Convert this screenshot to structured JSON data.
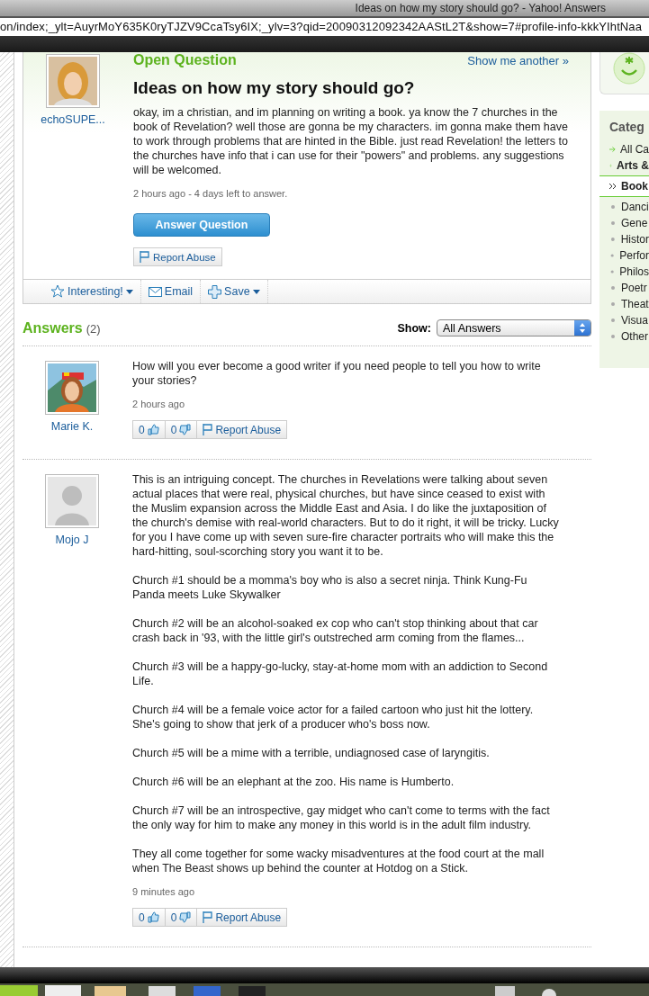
{
  "window": {
    "title": "Ideas on how my story should go? - Yahoo! Answers"
  },
  "address_bar": {
    "url": "on/index;_ylt=AuyrMoY635K0ryTJZV9CcaTsy6IX;_ylv=3?qid=20090312092342AAStL2T&show=7#profile-info-kkkYIhtNaa"
  },
  "question": {
    "status": "Open Question",
    "show_another": "Show me another »",
    "asker": "echoSUPE...",
    "title": "Ideas on how my story should go?",
    "body": "okay, im a christian, and im planning on writing a book. ya know the 7 churches in the book of Revelation? well those are gonna be my characters. im gonna make them have to work through problems that are hinted in the Bible. just read Revelation! the letters to the churches have info that i can use for their \"powers\" and problems. any suggestions will be welcomed.",
    "meta": "2 hours ago - 4 days left to answer.",
    "answer_button": "Answer Question",
    "report": "Report Abuse",
    "actions": [
      {
        "kind": "star",
        "label": "Interesting!",
        "menu": true
      },
      {
        "kind": "mail",
        "label": "Email",
        "menu": false
      },
      {
        "kind": "plus",
        "label": "Save",
        "menu": true
      }
    ]
  },
  "answers": {
    "title": "Answers",
    "count": "(2)",
    "show_label": "Show:",
    "show_value": "All Answers",
    "items": [
      {
        "name": "Marie K.",
        "paragraphs": [
          "How will you ever become a good writer if you need people to tell you how to write your stories?"
        ],
        "time": "2 hours ago",
        "up": "0",
        "down": "0",
        "report": "Report Abuse"
      },
      {
        "name": "Mojo J",
        "paragraphs": [
          "This is an intriguing concept. The churches in Revelations were talking about seven actual places that were real, physical churches, but have since ceased to exist with the Muslim expansion across the Middle East and Asia. I do like the juxtaposition of the church's demise with real-world characters. But to do it right, it will be tricky. Lucky for you I have come up with seven sure-fire character portraits who will make this the hard-hitting, soul-scorching story you want it to be.",
          "Church #1 should be a momma's boy who is also a secret ninja. Think Kung-Fu Panda meets Luke Skywalker",
          "Church #2 will be an alcohol-soaked ex cop who can't stop thinking about that car crash back in '93, with the little girl's outstreched arm coming from the flames...",
          "Church #3 will be a happy-go-lucky, stay-at-home mom with an addiction to Second Life.",
          "Church #4 will be a female voice actor for a failed cartoon who just hit the lottery. She's going to show that jerk of a producer who's boss now.",
          "Church #5 will be a mime with a terrible, undiagnosed case of laryngitis.",
          "Church #6 will be an elephant at the zoo. His name is Humberto.",
          "Church #7 will be an introspective, gay midget who can't come to terms with the fact the only way for him to make any money in this world is in the adult film industry.",
          "They all come together for some wacky misadventures at the food court at the mall when The Beast shows up behind the counter at Hotdog on a Stick."
        ],
        "time": "9 minutes ago",
        "up": "0",
        "down": "0",
        "report": "Report Abuse"
      }
    ]
  },
  "sidebar": {
    "title": "Categ",
    "items": [
      {
        "kind": "link",
        "label": "All Ca",
        "selected": false
      },
      {
        "kind": "parent",
        "label": "Arts &",
        "selected": false
      },
      {
        "kind": "current",
        "label": "Book",
        "selected": true
      },
      {
        "kind": "child",
        "label": "Danci",
        "selected": false
      },
      {
        "kind": "child",
        "label": "Gene",
        "selected": false
      },
      {
        "kind": "child",
        "label": "Histor",
        "selected": false
      },
      {
        "kind": "child",
        "label": "Perfor",
        "selected": false
      },
      {
        "kind": "child",
        "label": "Philos",
        "selected": false
      },
      {
        "kind": "child",
        "label": "Poetr",
        "selected": false
      },
      {
        "kind": "child",
        "label": "Theat",
        "selected": false
      },
      {
        "kind": "child",
        "label": "Visua",
        "selected": false
      },
      {
        "kind": "child",
        "label": "Other",
        "selected": false
      }
    ]
  }
}
